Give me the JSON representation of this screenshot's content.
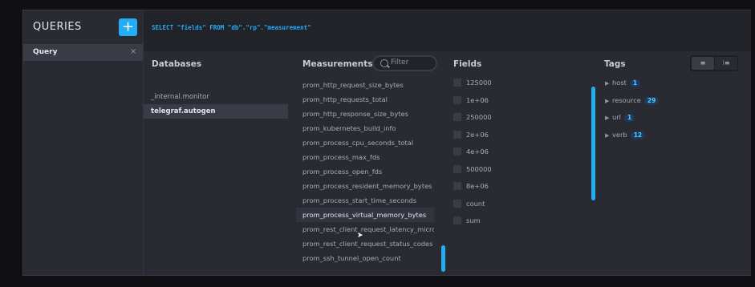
{
  "sidebar": {
    "title": "QUERIES",
    "add_icon": "plus-icon",
    "query_label": "Query",
    "close_icon": "close-icon"
  },
  "editor": {
    "query": "SELECT \"fields\" FROM \"db\".\"rp\".\"measurement\""
  },
  "explorer": {
    "databases_header": "Databases",
    "measurements_header": "Measurements",
    "fields_header": "Fields",
    "tags_header": "Tags",
    "filter_placeholder": "Filter",
    "databases": [
      {
        "name": "_internal.monitor",
        "active": false
      },
      {
        "name": "telegraf.autogen",
        "active": true
      }
    ],
    "measurements": [
      "prom_http_request_size_bytes",
      "prom_http_requests_total",
      "prom_http_response_size_bytes",
      "prom_kubernetes_build_info",
      "prom_process_cpu_seconds_total",
      "prom_process_max_fds",
      "prom_process_open_fds",
      "prom_process_resident_memory_bytes",
      "prom_process_start_time_seconds",
      "prom_process_virtual_memory_bytes",
      "prom_rest_client_request_latency_microseco",
      "prom_rest_client_request_status_codes",
      "prom_ssh_tunnel_open_count"
    ],
    "hovered_measurement_index": 9,
    "fields": [
      "125000",
      "1e+06",
      "250000",
      "2e+06",
      "4e+06",
      "500000",
      "8e+06",
      "count",
      "sum"
    ],
    "tags": [
      {
        "name": "host",
        "count": "1"
      },
      {
        "name": "resource",
        "count": "29"
      },
      {
        "name": "url",
        "count": "1"
      },
      {
        "name": "verb",
        "count": "12"
      }
    ],
    "toggle": [
      "≡",
      "⁝≡"
    ]
  },
  "colors": {
    "accent": "#22adf6",
    "panel": "#2a2a33",
    "editor": "#222229",
    "text": "#a8abb8"
  }
}
